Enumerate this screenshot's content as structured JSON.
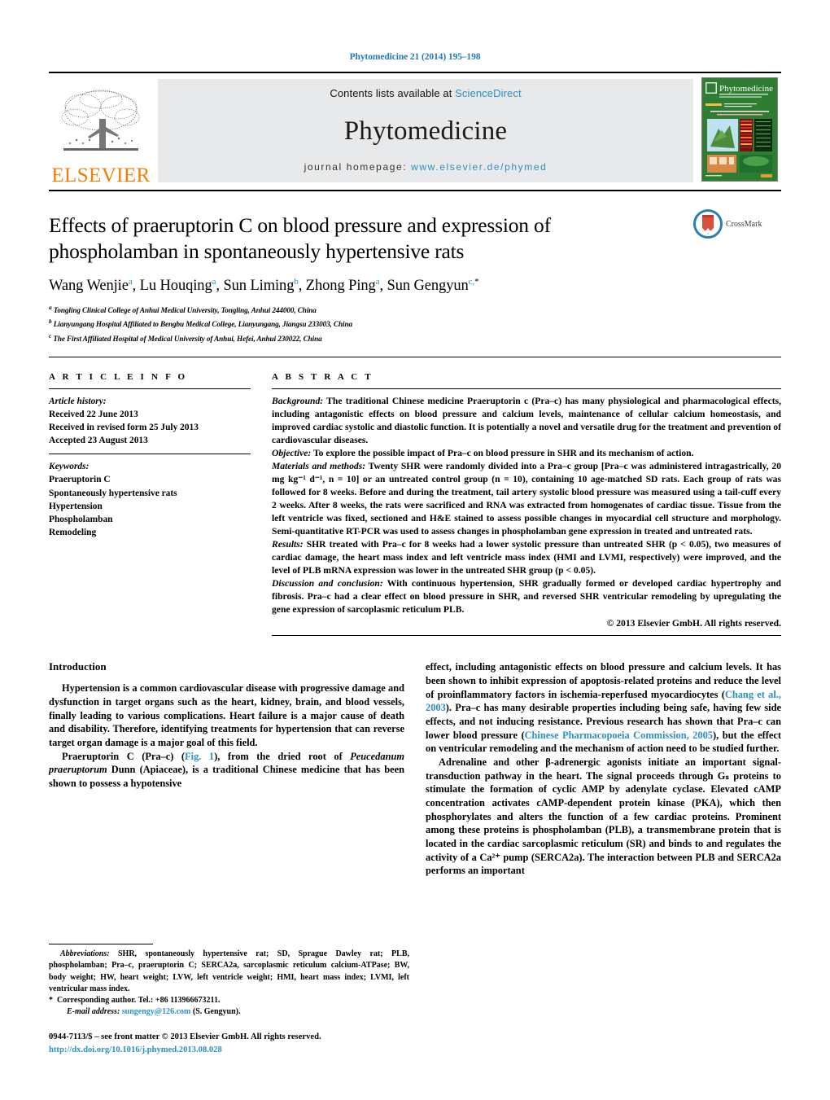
{
  "running_head": "Phytomedicine 21 (2014) 195–198",
  "masthead": {
    "publisher_name": "ELSEVIER",
    "contents_prefix": "Contents lists available at ",
    "contents_link": "ScienceDirect",
    "journal_title": "Phytomedicine",
    "homepage_prefix": "journal homepage: ",
    "homepage_link": "www.elsevier.de/phymed",
    "cover_title": "Phytomedicine",
    "cover_subtitle": "International Journal of Phytotherapy and Phytopharmacology"
  },
  "crossmark": {
    "label": "CrossMark"
  },
  "article": {
    "title": "Effects of praeruptorin C on blood pressure and expression of phospholamban in spontaneously hypertensive rats",
    "authors_html": "Wang Wenjie<sup>a</sup>, Lu Houqing<sup>a</sup>, Sun Liming<sup>b</sup>, Zhong Ping<sup>a</sup>, Sun Gengyun<sup>c,<span style=\"color:#000\">*</span></sup>",
    "affiliations": [
      {
        "marker": "a",
        "text": "Tongling Clinical College of Anhui Medical University, Tongling, Anhui 244000, China"
      },
      {
        "marker": "b",
        "text": "Lianyungang Hospital Affiliated to Bengbu Medical College, Lianyungang, Jiangsu 233003, China"
      },
      {
        "marker": "c",
        "text": "The First Affiliated Hospital of Medical University of Anhui, Hefei, Anhui 230022, China"
      }
    ]
  },
  "article_info": {
    "heading": "A R T I C L E   I N F O",
    "history_label": "Article history:",
    "history": [
      "Received 22 June 2013",
      "Received in revised form 25 July 2013",
      "Accepted 23 August 2013"
    ],
    "keywords_label": "Keywords:",
    "keywords": [
      "Praeruptorin C",
      "Spontaneously hypertensive rats",
      "Hypertension",
      "Phospholamban",
      "Remodeling"
    ]
  },
  "abstract": {
    "heading": "A B S T R A C T",
    "sections": [
      {
        "lead": "Background:",
        "text": " The traditional Chinese medicine Praeruptorin c (Pra–c) has many physiological and pharmacological effects, including antagonistic effects on blood pressure and calcium levels, maintenance of cellular calcium homeostasis, and improved cardiac systolic and diastolic function. It is potentially a novel and versatile drug for the treatment and prevention of cardiovascular diseases."
      },
      {
        "lead": "Objective:",
        "text": " To explore the possible impact of Pra–c on blood pressure in SHR and its mechanism of action."
      },
      {
        "lead": "Materials and methods:",
        "text": " Twenty SHR were randomly divided into a Pra–c group [Pra–c was administered intragastrically, 20 mg kg⁻¹ d⁻¹, n = 10] or an untreated control group (n = 10), containing 10 age-matched SD rats. Each group of rats was followed for 8 weeks. Before and during the treatment, tail artery systolic blood pressure was measured using a tail-cuff every 2 weeks. After 8 weeks, the rats were sacrificed and RNA was extracted from homogenates of cardiac tissue. Tissue from the left ventricle was fixed, sectioned and H&E stained to assess possible changes in myocardial cell structure and morphology. Semi-quantitative RT-PCR was used to assess changes in phospholamban gene expression in treated and untreated rats."
      },
      {
        "lead": "Results:",
        "text": " SHR treated with Pra–c for 8 weeks had a lower systolic pressure than untreated SHR (p < 0.05), two measures of cardiac damage, the heart mass index and left ventricle mass index (HMI and LVMI, respectively) were improved, and the level of PLB mRNA expression was lower in the untreated SHR group (p < 0.05)."
      },
      {
        "lead": "Discussion and conclusion:",
        "text": " With continuous hypertension, SHR gradually formed or developed cardiac hypertrophy and fibrosis. Pra–c had a clear effect on blood pressure in SHR, and reversed SHR ventricular remodeling by upregulating the gene expression of sarcoplasmic reticulum PLB."
      }
    ],
    "copyright": "© 2013 Elsevier GmbH. All rights reserved."
  },
  "body": {
    "intro_heading": "Introduction",
    "left_paragraphs": [
      "Hypertension is a common cardiovascular disease with progressive damage and dysfunction in target organs such as the heart, kidney, brain, and blood vessels, finally leading to various complications. Heart failure is a major cause of death and disability. Therefore, identifying treatments for hypertension that can reverse target organ damage is a major goal of this field."
    ],
    "left_para2_prefix": "Praeruptorin C (Pra–c) (",
    "left_para2_link": "Fig. 1",
    "left_para2_mid": "), from the dried root of ",
    "left_para2_italic": "Peucedanum praeruptorum",
    "left_para2_suffix": " Dunn (Apiaceae), is a traditional Chinese medicine that has been shown to possess a hypotensive",
    "right_para1_prefix": "effect, including antagonistic effects on blood pressure and calcium levels. It has been shown to inhibit expression of apoptosis-related proteins and reduce the level of proinflammatory factors in ischemia-reperfused myocardiocytes (",
    "right_para1_link1": "Chang et al., 2003",
    "right_para1_mid": "). Pra–c has many desirable properties including being safe, having few side effects, and not inducing resistance. Previous research has shown that Pra–c can lower blood pressure (",
    "right_para1_link2": "Chinese Pharmacopoeia Commission, 2005",
    "right_para1_suffix": "), but the effect on ventricular remodeling and the mechanism of action need to be studied further.",
    "right_para2": "Adrenaline and other β-adrenergic agonists initiate an important signal-transduction pathway in the heart. The signal proceeds through Gₛ proteins to stimulate the formation of cyclic AMP by adenylate cyclase. Elevated cAMP concentration activates cAMP-dependent protein kinase (PKA), which then phosphorylates and alters the function of a few cardiac proteins. Prominent among these proteins is phospholamban (PLB), a transmembrane protein that is located in the cardiac sarcoplasmic reticulum (SR) and binds to and regulates the activity of a Ca²⁺ pump (SERCA2a). The interaction between PLB and SERCA2a performs an important"
  },
  "footnotes": {
    "abbrev_label": "Abbreviations:",
    "abbrev_text": " SHR, spontaneously hypertensive rat; SD, Sprague Dawley rat; PLB, phospholamban; Pra–c, praeruptorin C; SERCA2a, sarcoplasmic reticulum calcium-ATPase; BW, body weight; HW, heart weight; LVW, left ventricle weight; HMI, heart mass index; LVMI, left ventricular mass index.",
    "corresponding": "Corresponding author. Tel.: +86 113966673211.",
    "email_label": "E-mail address:",
    "email": "sungengy@126.com",
    "email_owner": " (S. Gengyun).",
    "frontmatter": "0944-7113/$ – see front matter © 2013 Elsevier GmbH. All rights reserved.",
    "doi": "http://dx.doi.org/10.1016/j.phymed.2013.08.028"
  },
  "colors": {
    "link_blue": "#2b8fc4",
    "elsevier_orange": "#f08000",
    "banner_gray": "#e8e9ea",
    "cover_green": "#2f7d32"
  }
}
